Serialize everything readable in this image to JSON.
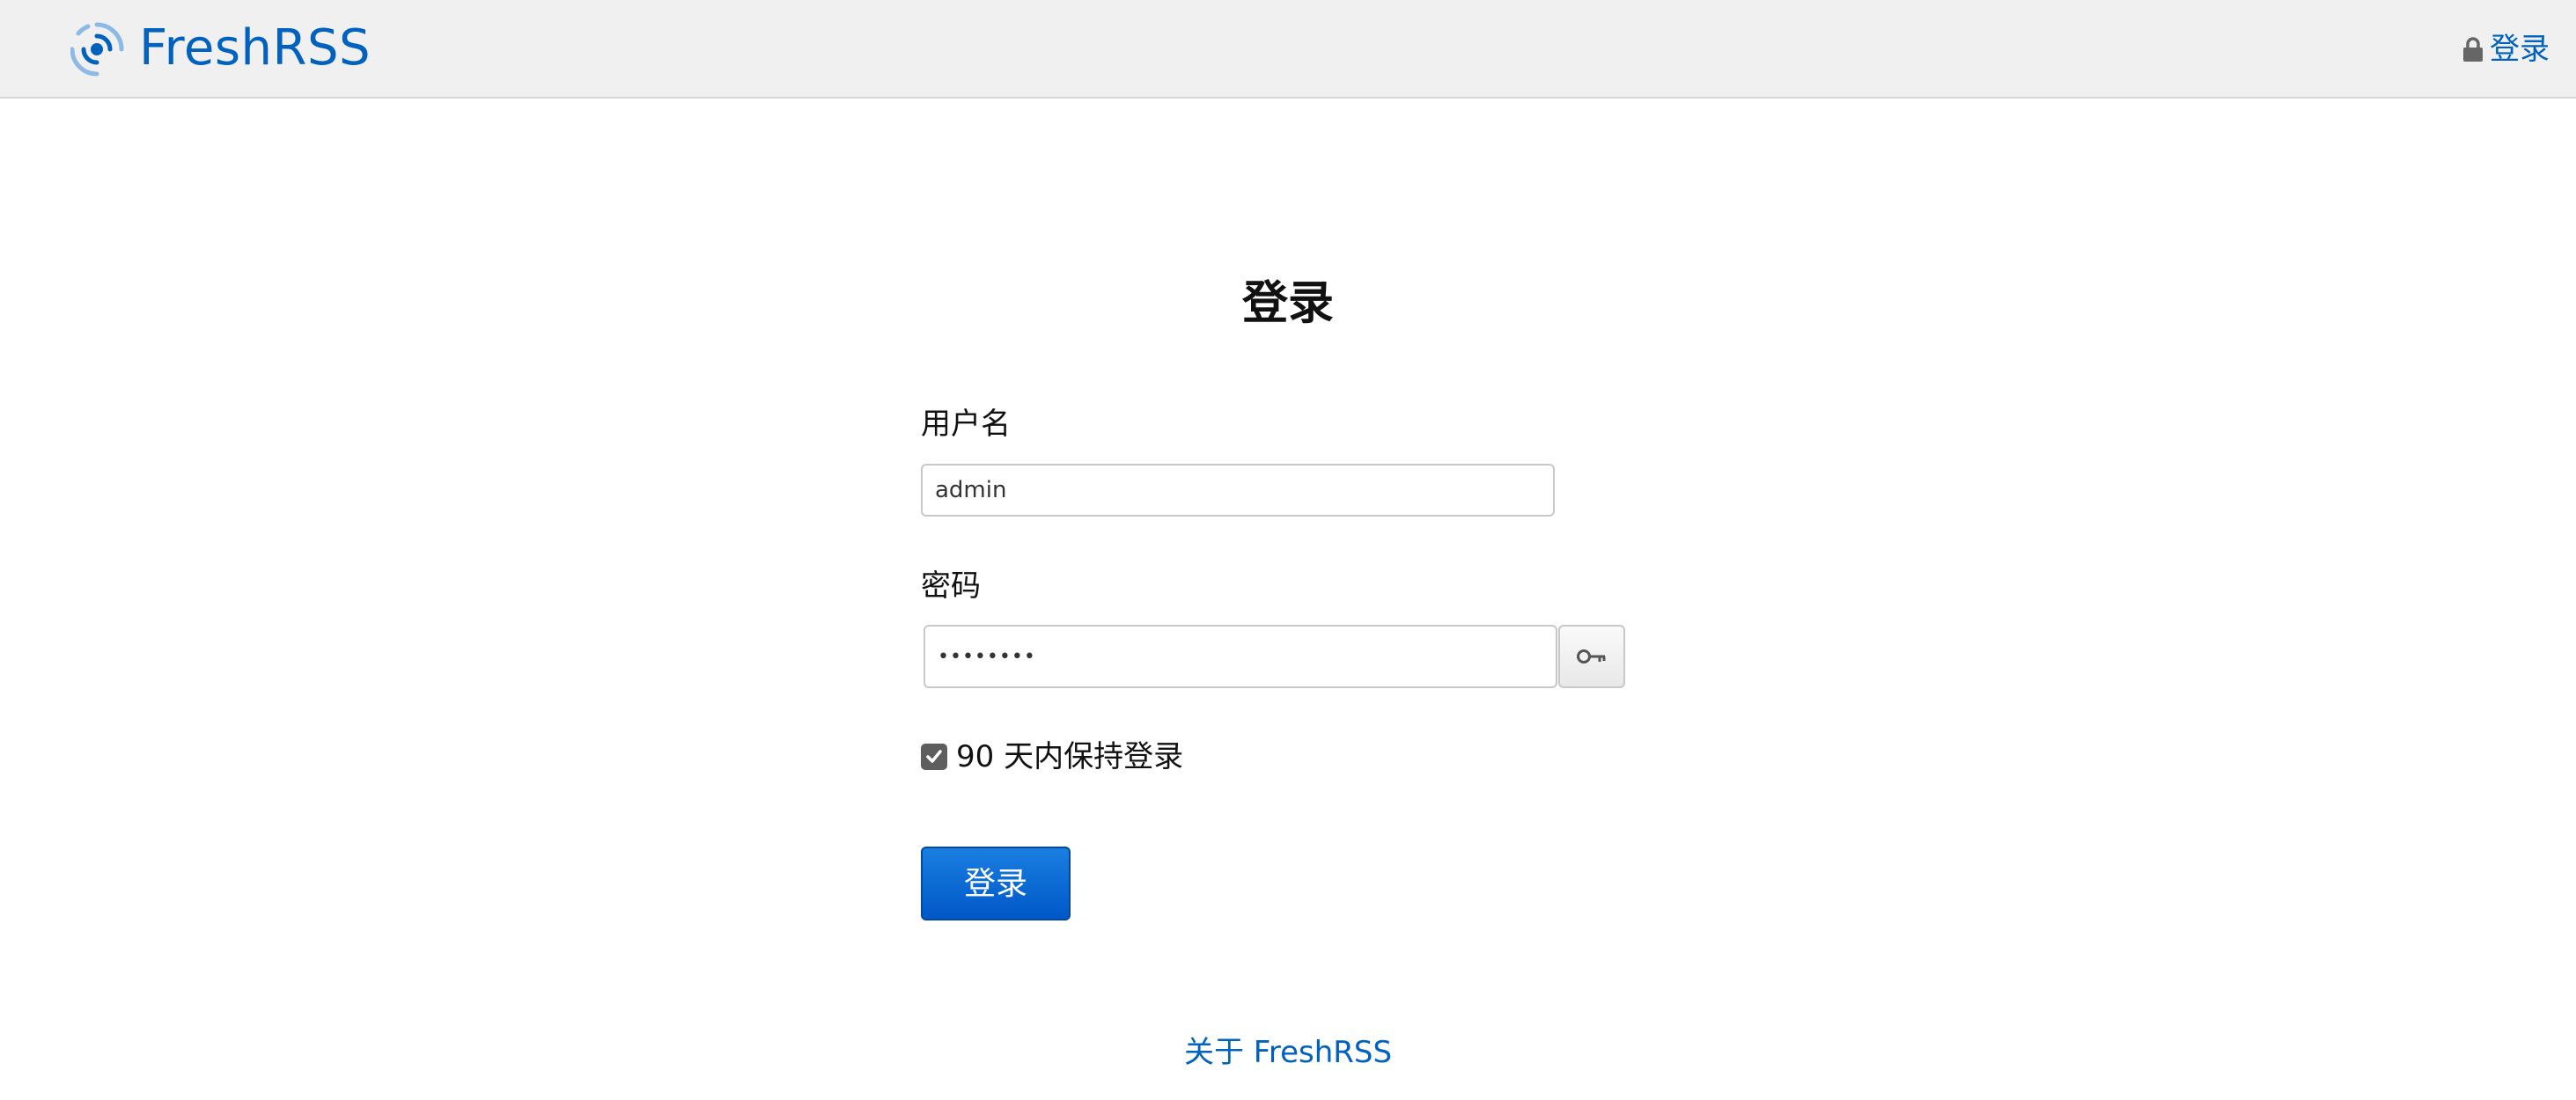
{
  "header": {
    "logo_text": "FreshRSS",
    "login_link": "登录",
    "brand_color": "#0062be"
  },
  "form": {
    "title": "登录",
    "username": {
      "label": "用户名",
      "value": "admin"
    },
    "password": {
      "label": "密码",
      "value": "••••••••",
      "toggle_icon": "key-icon"
    },
    "remember": {
      "checked": true,
      "label": "90 天内保持登录"
    },
    "submit_label": "登录"
  },
  "footer": {
    "about_link": "关于 FreshRSS"
  }
}
